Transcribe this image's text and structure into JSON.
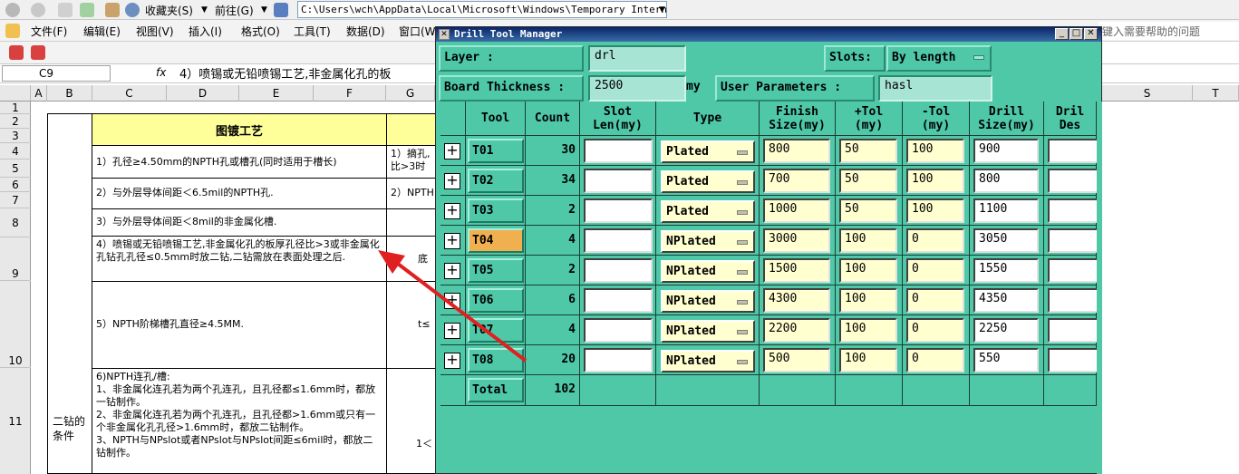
{
  "ie": {
    "favorites": "收藏夹(S)",
    "goto": "前往(G)",
    "address": "C:\\Users\\wch\\AppData\\Local\\Microsoft\\Windows\\Temporary Internet F"
  },
  "excel": {
    "menus": [
      "文件(F)",
      "编辑(E)",
      "视图(V)",
      "插入(I)",
      "格式(O)",
      "工具(T)",
      "数据(D)",
      "窗口(W)"
    ],
    "help_placeholder": "键入需要帮助的问题",
    "name_box": "C9",
    "fx": "fx",
    "formula": "4）喷锡或无铅喷锡工艺,非金属化孔的板",
    "columns": [
      "A",
      "B",
      "C",
      "D",
      "E",
      "F",
      "G",
      "S",
      "T"
    ],
    "rows": [
      "1",
      "2",
      "3",
      "4",
      "5",
      "6",
      "7",
      "8",
      "9",
      "10",
      "11"
    ],
    "header_cell": "图镀工艺",
    "merged_label": "二钻的条件",
    "cells": [
      "1）孔径≥4.50mm的NPTH孔或槽孔(同时适用于槽长)",
      "2）与外层导体间距＜6.5mil的NPTH孔.",
      "3）与外层导体间距＜8mil的非金属化槽.",
      "4）喷锡或无铅喷锡工艺,非金属化孔的板厚孔径比>3或非金属化孔钻孔孔径≤0.5mm时放二钻,二钻需放在表面处理之后.",
      "5）NPTH阶梯槽孔直径≥4.5MM.",
      "6)NPTH连孔/槽:\n1、非金属化连孔若为两个孔连孔，且孔径都≤1.6mm时，都放一钻制作。\n2、非金属化连孔若为两个孔连孔，且孔径都>1.6mm或只有一个非金属化孔孔径>1.6mm时，都放二钻制作。\n3、NPTH与NPslot或者NPslot与NPslot间距≤6mil时，都放二钻制作。"
    ],
    "g_cells": [
      "1）摘孔,",
      "比>3时",
      "2）NPTH",
      "底",
      "t≤",
      "1＜"
    ]
  },
  "dialog": {
    "title": "Drill Tool Manager",
    "layer_label": "Layer          :",
    "layer_value": "drl",
    "slots_label": "Slots:",
    "slots_value": "By length",
    "thickness_label": "Board Thickness  :",
    "thickness_value": "2500",
    "thickness_unit": "my",
    "user_params_label": "User Parameters  :",
    "user_params_value": "hasl",
    "headers": [
      "",
      "Tool",
      "Count",
      "Slot\nLen(my)",
      "Type",
      "Finish\nSize(my)",
      "+Tol\n(my)",
      "-Tol\n(my)",
      "Drill\nSize(my)",
      "Dril\nDes"
    ],
    "rows": [
      {
        "tool": "T01",
        "count": "30",
        "slot": "",
        "type": "Plated",
        "finish": "800",
        "ptol": "50",
        "ntol": "100",
        "drill": "900"
      },
      {
        "tool": "T02",
        "count": "34",
        "slot": "",
        "type": "Plated",
        "finish": "700",
        "ptol": "50",
        "ntol": "100",
        "drill": "800"
      },
      {
        "tool": "T03",
        "count": "2",
        "slot": "",
        "type": "Plated",
        "finish": "1000",
        "ptol": "50",
        "ntol": "100",
        "drill": "1100"
      },
      {
        "tool": "T04",
        "count": "4",
        "slot": "",
        "type": "NPlated",
        "finish": "3000",
        "ptol": "100",
        "ntol": "0",
        "drill": "3050"
      },
      {
        "tool": "T05",
        "count": "2",
        "slot": "",
        "type": "NPlated",
        "finish": "1500",
        "ptol": "100",
        "ntol": "0",
        "drill": "1550"
      },
      {
        "tool": "T06",
        "count": "6",
        "slot": "",
        "type": "NPlated",
        "finish": "4300",
        "ptol": "100",
        "ntol": "0",
        "drill": "4350"
      },
      {
        "tool": "T07",
        "count": "4",
        "slot": "",
        "type": "NPlated",
        "finish": "2200",
        "ptol": "100",
        "ntol": "0",
        "drill": "2250"
      },
      {
        "tool": "T08",
        "count": "20",
        "slot": "",
        "type": "NPlated",
        "finish": "500",
        "ptol": "100",
        "ntol": "0",
        "drill": "550"
      }
    ],
    "selected_tool": "T04",
    "total_label": "Total",
    "total_count": "102"
  },
  "colors": {
    "dialog_bg": "#4fc8a8",
    "selected": "#f0b050",
    "header_yellow": "#ffff99",
    "arrow": "#e02020"
  }
}
